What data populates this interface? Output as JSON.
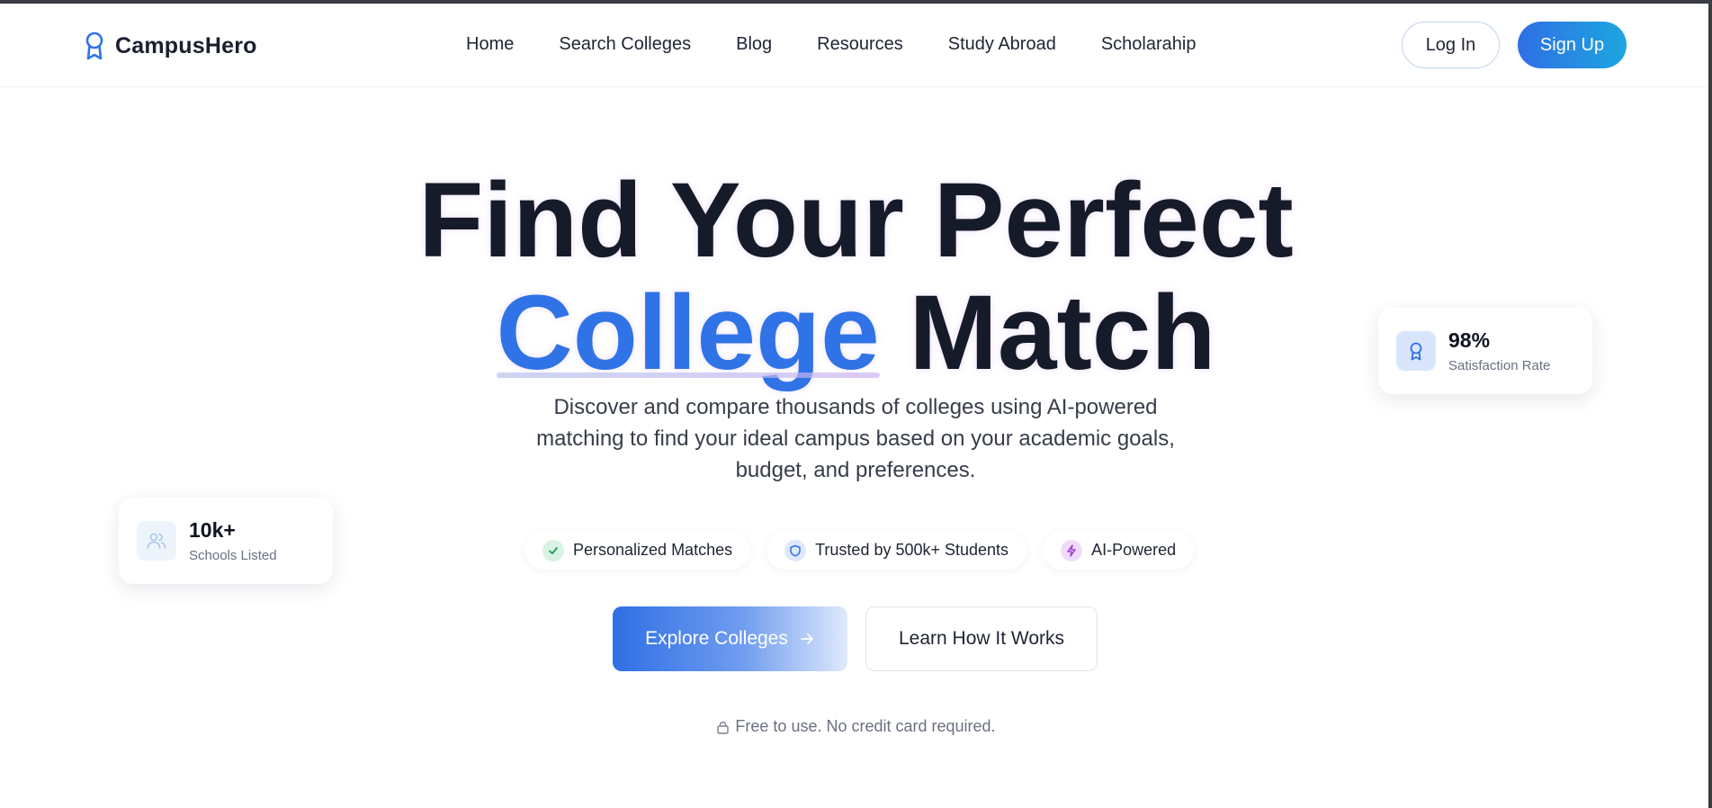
{
  "brand": {
    "name": "CampusHero",
    "icon": "award-icon",
    "accent_color": "#2f73e6"
  },
  "nav": {
    "items": [
      {
        "label": "Home"
      },
      {
        "label": "Search Colleges"
      },
      {
        "label": "Blog"
      },
      {
        "label": "Resources"
      },
      {
        "label": "Study Abroad"
      },
      {
        "label": "Scholarahip"
      }
    ]
  },
  "auth": {
    "login_label": "Log In",
    "signup_label": "Sign Up"
  },
  "hero": {
    "line1": "Find Your Perfect",
    "line2_accent": "College",
    "line2_rest": "Match",
    "subtitle": "Discover and compare thousands of colleges using AI-powered matching to find your ideal campus based on your academic goals, budget, and preferences."
  },
  "features": [
    {
      "label": "Personalized Matches",
      "icon": "check-icon",
      "color": "#1f9d55"
    },
    {
      "label": "Trusted by 500k+ Students",
      "icon": "shield-icon",
      "color": "#2f6fe4"
    },
    {
      "label": "AI-Powered",
      "icon": "lightning-icon",
      "color": "#9b3fd6"
    }
  ],
  "cta": {
    "primary_label": "Explore Colleges",
    "primary_icon": "arrow-right-icon",
    "secondary_label": "Learn How It Works"
  },
  "note": {
    "text": "Free to use. No credit card required.",
    "icon": "lock-icon"
  },
  "stats": {
    "schools": {
      "value": "10k+",
      "label": "Schools Listed",
      "icon": "users-icon"
    },
    "satisfaction": {
      "value": "98%",
      "label": "Satisfaction Rate",
      "icon": "award-icon"
    }
  }
}
